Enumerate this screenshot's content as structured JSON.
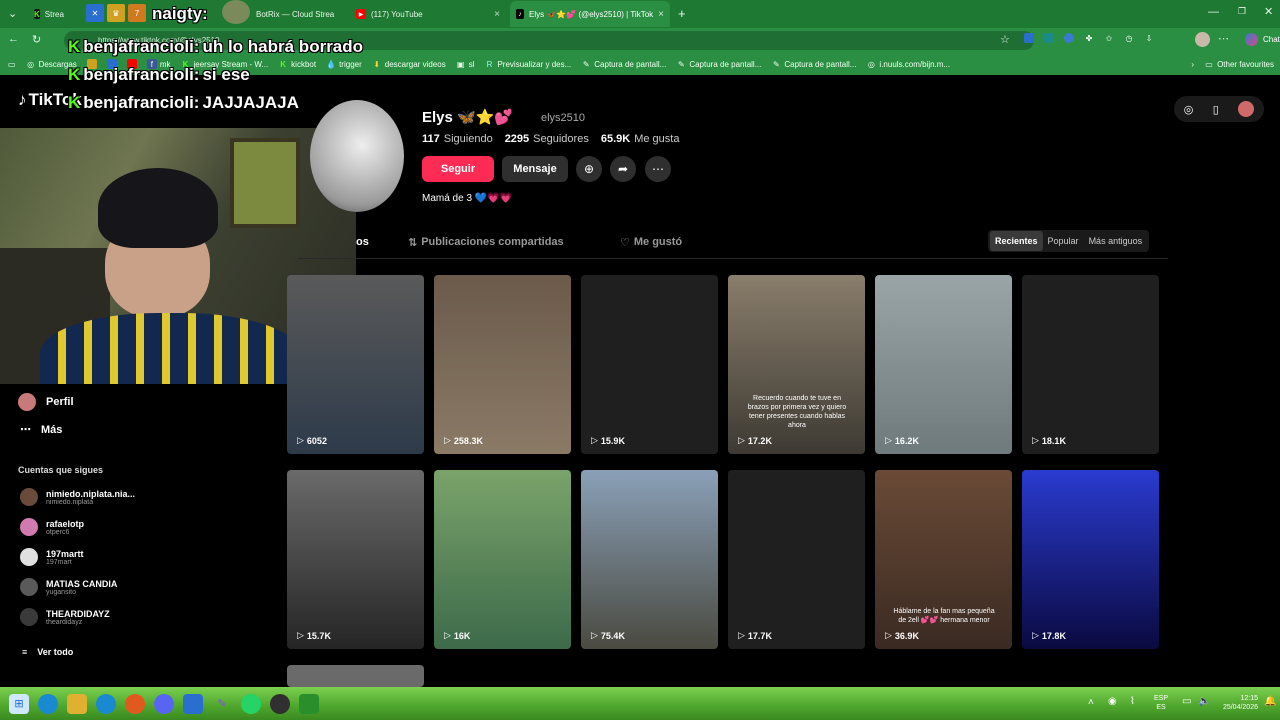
{
  "browser": {
    "tabs": [
      {
        "title": "Strea",
        "close": "×"
      },
      {
        "title": "BotRix — Cloud Strea",
        "close": "×"
      },
      {
        "title": "(117) YouTube",
        "close": "×"
      },
      {
        "title": "Elys 🦋⭐💕 (@elys2510) | TikTok",
        "close": "×"
      }
    ],
    "new_tab": "+",
    "streamer_overlay": "naigty:",
    "url": "https://www.tiktok.com/@elys2510",
    "bookmarks": [
      "Descargas",
      "jeersay Stream - W...",
      "kickbot",
      "trigger",
      "descargar videos",
      "sl",
      "Previsualizar y des...",
      "Captura de pantall...",
      "Captura de pantall...",
      "Captura de pantall...",
      "i.nuuls.com/bijn.m..."
    ],
    "bookmarks_short": [
      "mk"
    ],
    "other_favourites": "Other favourites",
    "chat_label": "Chat"
  },
  "chat_overlay": [
    {
      "user": "benjafrancioli:",
      "message": "uh lo habrá borrado"
    },
    {
      "user": "benjafrancioli:",
      "message": "si ese"
    },
    {
      "user": "benjafrancioli:",
      "message": "JAJJAJAJA"
    }
  ],
  "tiktok": {
    "logo": "TikTok",
    "nav": [
      {
        "label": "Perfil"
      },
      {
        "label": "Más"
      }
    ],
    "following_title": "Cuentas que sigues",
    "following": [
      {
        "name": "nimiedo.niplata.nia...",
        "handle": "nimiedo.niplata"
      },
      {
        "name": "rafaelotp",
        "handle": "otperc6"
      },
      {
        "name": "197martt",
        "handle": "197mart"
      },
      {
        "name": "MATIAS CANDIA",
        "handle": "yugansito"
      },
      {
        "name": "THEARDIDAYZ",
        "handle": "theardidayz"
      }
    ],
    "see_all": "Ver todo",
    "profile": {
      "display_name": "Elys 🦋⭐💕",
      "username": "elys2510",
      "following_count": "117",
      "following_label": "Siguiendo",
      "followers_count": "2295",
      "followers_label": "Seguidores",
      "likes_count": "65.9K",
      "likes_label": "Me gusta",
      "follow_btn": "Seguir",
      "message_btn": "Mensaje",
      "bio": "Mamá de 3 💙💗💗"
    },
    "tabs": [
      "os",
      "Publicaciones compartidas",
      "Me gustó"
    ],
    "sort": [
      "Recientes",
      "Popular",
      "Más antiguos"
    ],
    "videos": [
      {
        "views": "6052",
        "caption": "",
        "colors": [
          "#5a5a5a",
          "#2d3a4a"
        ]
      },
      {
        "views": "258.3K",
        "caption": "",
        "colors": [
          "#6b5a4a",
          "#8a7a66"
        ]
      },
      {
        "views": "15.9K",
        "caption": "",
        "colors": [
          "#1f1f1f",
          "#1f1f1f"
        ]
      },
      {
        "views": "17.2K",
        "caption": "Recuerdo cuando te tuve en brazos por primera vez y quiero tener presentes cuando hablas ahora",
        "colors": [
          "#8a7e6c",
          "#3e3a33"
        ]
      },
      {
        "views": "16.2K",
        "caption": "",
        "colors": [
          "#9aa5a8",
          "#6f7a7c"
        ]
      },
      {
        "views": "18.1K",
        "caption": "",
        "colors": [
          "#1f1f1f",
          "#1f1f1f"
        ]
      },
      {
        "views": "15.7K",
        "caption": "",
        "colors": [
          "#6a6a6a",
          "#252525"
        ]
      },
      {
        "views": "16K",
        "caption": "",
        "colors": [
          "#7aa36a",
          "#3d6a4a"
        ]
      },
      {
        "views": "75.4K",
        "caption": "",
        "colors": [
          "#8aa0b8",
          "#4a4a40"
        ]
      },
      {
        "views": "17.7K",
        "caption": "",
        "colors": [
          "#1f1f1f",
          "#1f1f1f"
        ]
      },
      {
        "views": "36.9K",
        "caption": "Háblame de la fan mas pequeña de 2ell 💕💕 hermana menor",
        "colors": [
          "#6a4a36",
          "#3a2a22"
        ]
      },
      {
        "views": "17.8K",
        "caption": "",
        "colors": [
          "#2a3bd0",
          "#0a0a40"
        ]
      }
    ]
  },
  "taskbar": {
    "lang_top": "ESP",
    "lang_bottom": "ES",
    "time": "12:15",
    "date": "25/04/2026"
  }
}
